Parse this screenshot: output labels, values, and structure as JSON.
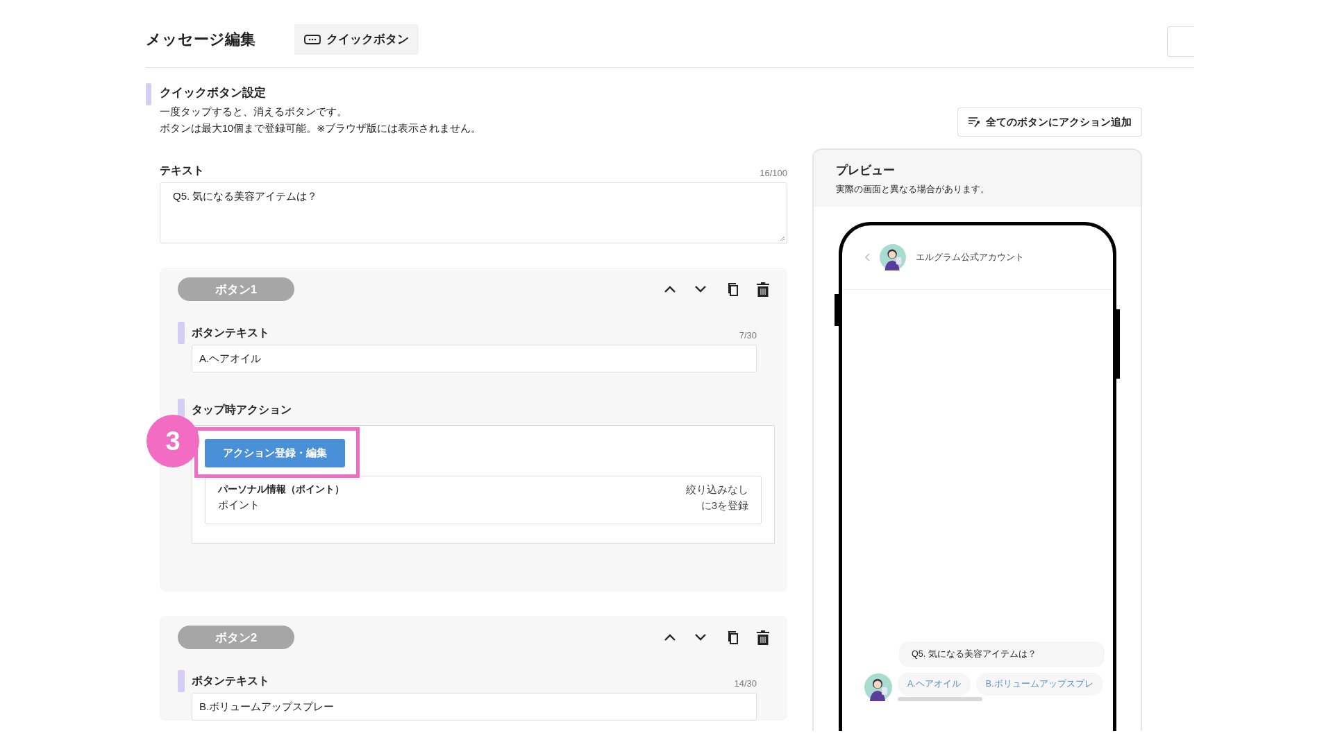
{
  "header": {
    "title": "メッセージ編集",
    "tab": {
      "label": "クイックボタン"
    }
  },
  "section": {
    "title": "クイックボタン設定",
    "description": [
      "一度タップすると、消えるボタンです。",
      "ボタンは最大10個まで登録可能。※ブラウザ版には表示されません。"
    ],
    "add_all_button": "全てのボタンにアクション追加"
  },
  "text_field": {
    "label": "テキスト",
    "count": "16/100",
    "value": "Q5. 気になる美容アイテムは？"
  },
  "buttons": [
    {
      "badge": "ボタン1",
      "text_label": "ボタンテキスト",
      "count": "7/30",
      "value": "A.ヘアオイル",
      "action_label": "タップ時アクション",
      "action_button": "アクション登録・編集",
      "action": {
        "title": "パーソナル情報（ポイント）",
        "subtitle": "ポイント",
        "filter": "絞り込みなし",
        "result": "に3を登録"
      }
    },
    {
      "badge": "ボタン2",
      "text_label": "ボタンテキスト",
      "count": "14/30",
      "value": "B.ボリュームアップスプレー"
    }
  ],
  "annotation": {
    "step": "3"
  },
  "preview": {
    "title": "プレビュー",
    "note": "実際の画面と異なる場合があります。",
    "account_name": "エルグラム公式アカウント",
    "message": "Q5. 気になる美容アイテムは？",
    "quick_replies": [
      "A.ヘアオイル",
      "B.ボリュームアップスプレ"
    ]
  }
}
